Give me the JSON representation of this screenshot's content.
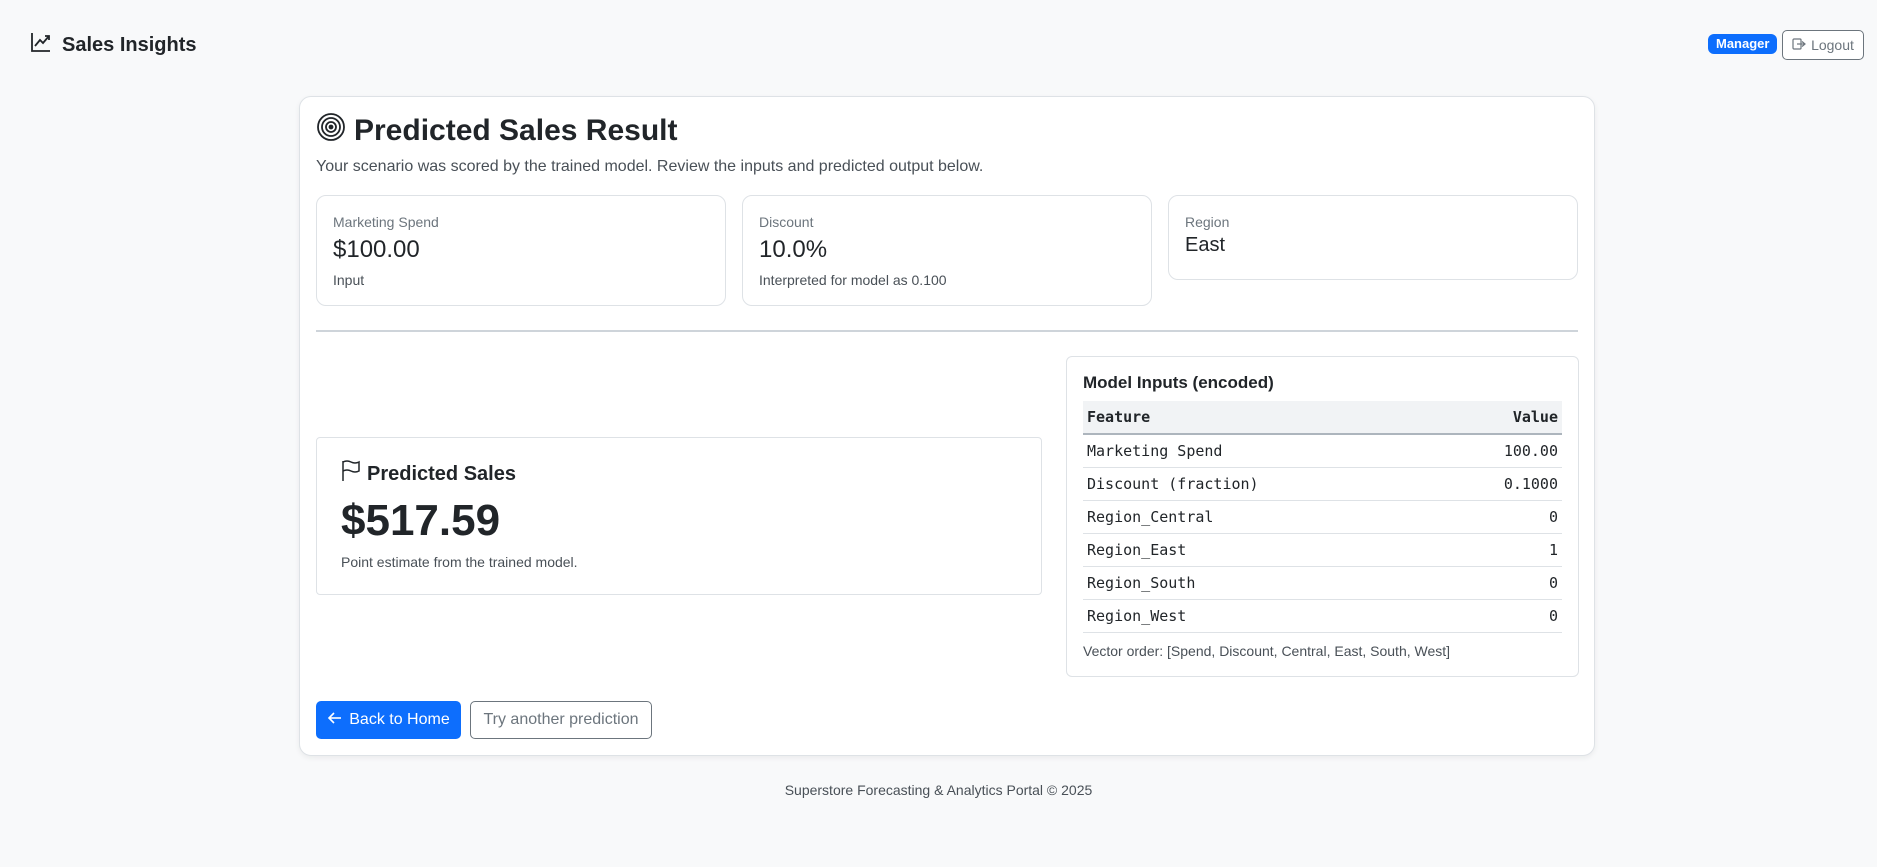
{
  "nav": {
    "brand": "Sales Insights",
    "brand_icon": "graph-up-icon",
    "role_badge": "Manager",
    "logout_label": "Logout"
  },
  "result": {
    "title": "Predicted Sales Result",
    "title_icon": "bullseye-icon",
    "subtitle": "Your scenario was scored by the trained model. Review the inputs and predicted output below."
  },
  "stats": [
    {
      "label": "Marketing Spend",
      "value": "$100.00",
      "note": "Input"
    },
    {
      "label": "Discount",
      "value": "10.0%",
      "note": "Interpreted for model as 0.100"
    },
    {
      "label": "Region",
      "value": "East"
    }
  ],
  "prediction": {
    "title": "Predicted Sales",
    "icon": "flag-icon",
    "value": "$517.59",
    "note": "Point estimate from the trained model."
  },
  "model_inputs": {
    "title": "Model Inputs (encoded)",
    "headers": [
      "Feature",
      "Value"
    ],
    "rows": [
      {
        "feature": "Marketing Spend",
        "value": "100.00"
      },
      {
        "feature": "Discount (fraction)",
        "value": "0.1000"
      },
      {
        "feature": "Region_Central",
        "value": "0"
      },
      {
        "feature": "Region_East",
        "value": "1"
      },
      {
        "feature": "Region_South",
        "value": "0"
      },
      {
        "feature": "Region_West",
        "value": "0"
      }
    ],
    "vector_note": "Vector order: [Spend, Discount, Central, East, South, West]"
  },
  "actions": {
    "back_label": "Back to Home",
    "try_label": "Try another prediction"
  },
  "footer": "Superstore Forecasting & Analytics Portal © 2025",
  "colors": {
    "primary": "#0d6efd",
    "background": "#f8f9fa",
    "border": "#dee2e6",
    "text": "#212529",
    "muted": "#6c757d"
  }
}
